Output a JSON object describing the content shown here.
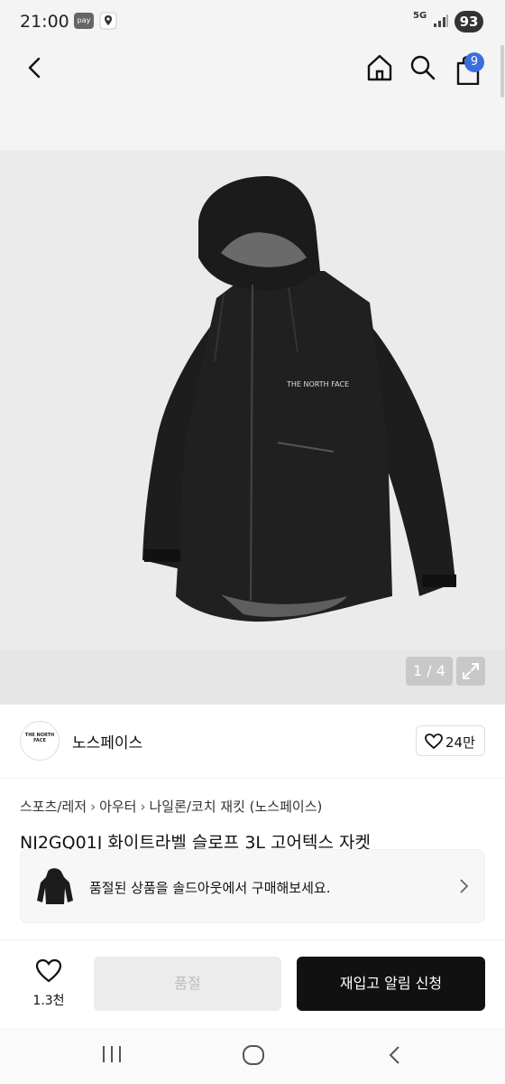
{
  "status_bar": {
    "time": "21:00",
    "pay_label": "pay",
    "network": "5G",
    "battery": "93"
  },
  "header": {
    "cart_count": "9"
  },
  "gallery": {
    "page_indicator": "1 / 4",
    "jacket_logo": "THE NORTH FACE"
  },
  "brand": {
    "logo_text": "THE NORTH FACE",
    "name": "노스페이스",
    "like_count": "24만"
  },
  "product": {
    "breadcrumb": [
      "스포츠/레저",
      "아우터",
      "나일론/코치 재킷 (노스페이스)"
    ],
    "title": "NJ2GQ01J 화이트라벨 슬로프 3L 고어텍스 자켓"
  },
  "soldout_notice": {
    "text": "품절된 상품을 솔드아웃에서 구매해보세요."
  },
  "action_bar": {
    "wish_count": "1.3천",
    "soldout_label": "품절",
    "restock_label": "재입고 알림 신청"
  },
  "colors": {
    "accent": "#3a6dde",
    "primary_button": "#111111",
    "disabled_button": "#ececec"
  }
}
